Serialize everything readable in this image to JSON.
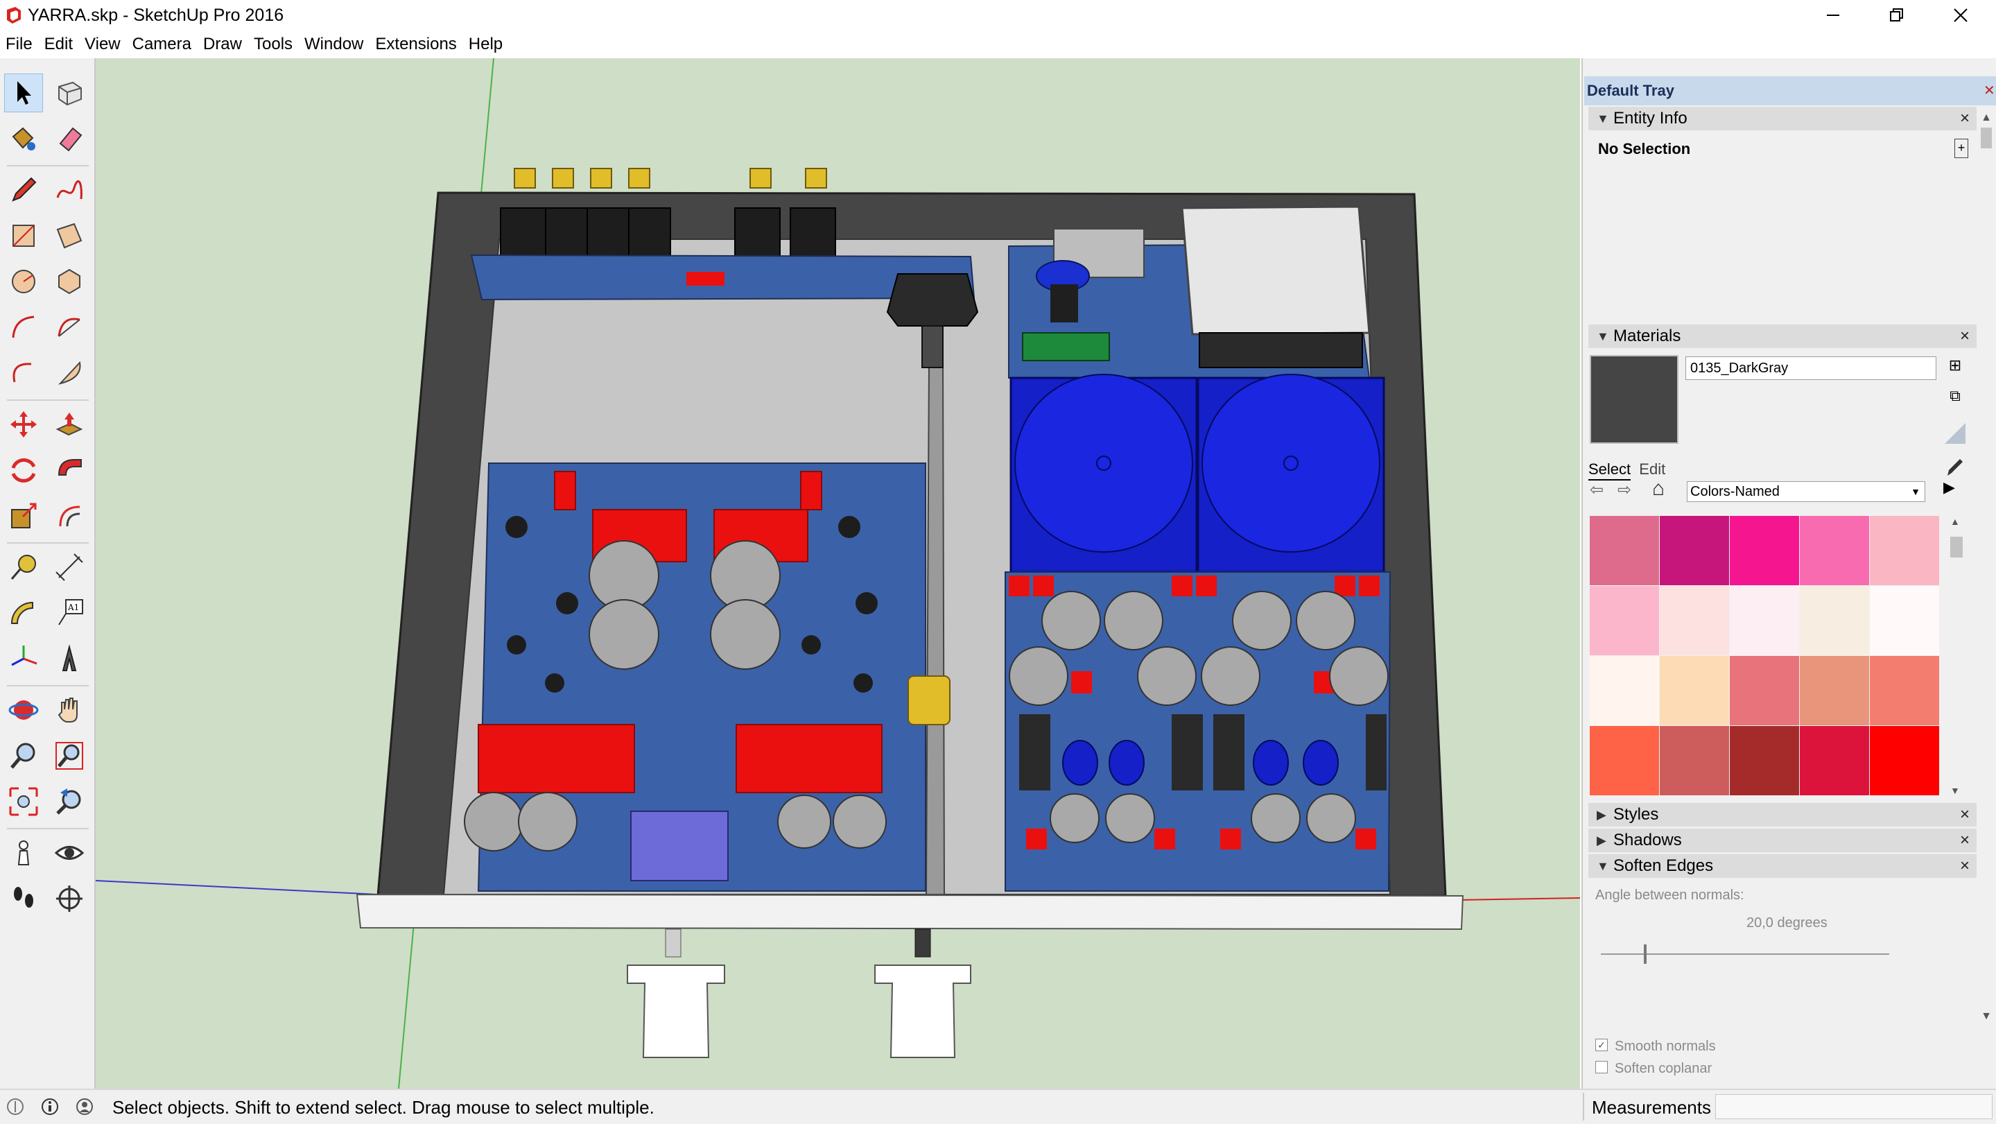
{
  "window": {
    "title": "YARRA.skp - SketchUp Pro 2016",
    "app_icon": "sketchup-logo-icon",
    "controls": [
      "minimize-icon",
      "restore-icon",
      "close-icon"
    ]
  },
  "menu": [
    "File",
    "Edit",
    "View",
    "Camera",
    "Draw",
    "Tools",
    "Window",
    "Extensions",
    "Help"
  ],
  "toolbar": {
    "tools": [
      "select-icon",
      "make-component-icon",
      "paint-bucket-icon",
      "eraser-icon",
      "pencil-icon",
      "freehand-icon",
      "rectangle-icon",
      "rotated-rectangle-icon",
      "circle-icon",
      "polygon-icon",
      "arc-icon",
      "two-point-arc-icon",
      "three-point-arc-icon",
      "pie-icon",
      "move-icon",
      "push-pull-icon",
      "rotate-icon",
      "follow-me-icon",
      "scale-icon",
      "offset-icon",
      "tape-measure-icon",
      "dimension-icon",
      "protractor-icon",
      "text-icon",
      "axes-icon",
      "3d-text-icon",
      "orbit-icon",
      "pan-icon",
      "zoom-icon",
      "zoom-window-icon",
      "zoom-extents-icon",
      "previous-view-icon",
      "position-camera-icon",
      "look-around-icon",
      "walk-icon",
      "section-plane-icon"
    ],
    "text_tool_glyph": "A1"
  },
  "tray": {
    "title": "Default Tray",
    "entity_info": {
      "title": "Entity Info",
      "selection": "No Selection"
    },
    "materials": {
      "title": "Materials",
      "material_name": "0135_DarkGray",
      "preview_color": "#454545",
      "tab_select": "Select",
      "tab_edit": "Edit",
      "library": "Colors-Named",
      "swatches": [
        "#df6b8c",
        "#c6157b",
        "#f4158f",
        "#f86bb1",
        "#fbb6c3",
        "#fcb6cb",
        "#fde0e0",
        "#fdeef4",
        "#f8ede1",
        "#fff9f9",
        "#fff5ee",
        "#fddbb5",
        "#e8737a",
        "#e8957b",
        "#f37d6f",
        "#ff6347",
        "#cd5c5c",
        "#a52a2a",
        "#dc143c",
        "#ff0000"
      ]
    },
    "styles": {
      "title": "Styles"
    },
    "shadows": {
      "title": "Shadows"
    },
    "soften_edges": {
      "title": "Soften Edges",
      "angle_label": "Angle between normals:",
      "angle_value": "20,0  degrees",
      "slider_fraction": 0.15,
      "smooth_normals": "Smooth normals",
      "smooth_checked": true,
      "soften_coplanar": "Soften coplanar",
      "coplanar_checked": false
    }
  },
  "status": {
    "icons": [
      "geo-location-icon",
      "credits-icon",
      "user-icon"
    ],
    "text": "Select objects. Shift to extend select. Drag mouse to select multiple.",
    "measurements_label": "Measurements",
    "measurements_value": ""
  },
  "model": {
    "background": "#cfdec6",
    "chassis_color": "#454545",
    "pcb_color": "#3b62a8",
    "heatsink_color": "#1520c8",
    "capacitor_red": "#ea1010"
  }
}
